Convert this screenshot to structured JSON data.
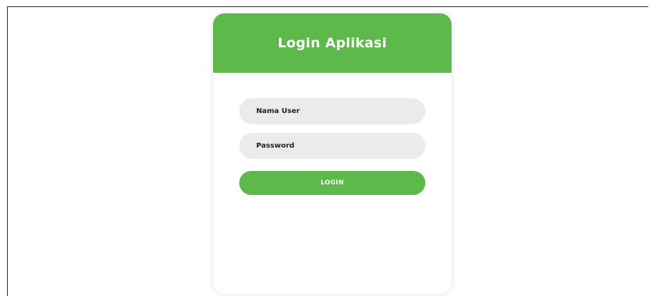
{
  "login_card": {
    "title": "Login Aplikasi",
    "username_placeholder": "Nama User",
    "password_placeholder": "Password",
    "login_label": "LOGIN"
  },
  "colors": {
    "accent": "#5cb94a",
    "field_bg": "#ebebeb",
    "background": "#ffffff"
  }
}
